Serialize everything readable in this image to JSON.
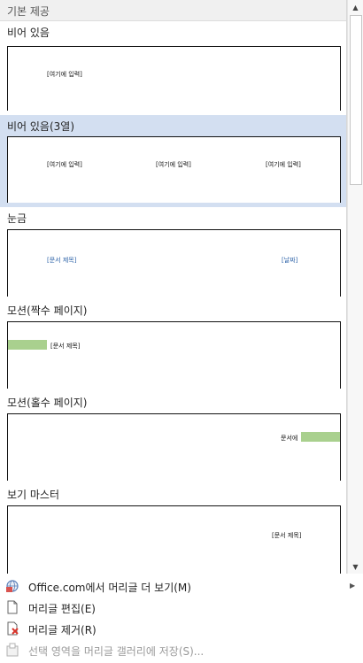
{
  "section": {
    "title": "기본 제공"
  },
  "items": [
    {
      "label": "비어 있음",
      "placeholders": [
        "[여기에 입력]"
      ]
    },
    {
      "label": "비어 있음(3열)",
      "placeholders": [
        "[여기에 입력]",
        "[여기에 입력]",
        "[여기에 입력]"
      ]
    },
    {
      "label": "눈금",
      "placeholders": [
        "[문서 제목]",
        "[날짜]"
      ]
    },
    {
      "label": "모션(짝수 페이지)",
      "placeholders": [
        "[문서 제목]"
      ]
    },
    {
      "label": "모션(홀수 페이지)",
      "placeholders": [
        "문서에"
      ]
    },
    {
      "label": "보기 마스터",
      "placeholders": [
        "[문서 제목]"
      ]
    }
  ],
  "menu": [
    {
      "label": "Office.com에서 머리글 더 보기(M)",
      "icon": "office-globe-icon",
      "enabled": true,
      "submenu": true
    },
    {
      "label": "머리글 편집(E)",
      "icon": "page-icon",
      "enabled": true
    },
    {
      "label": "머리글 제거(R)",
      "icon": "remove-page-icon",
      "enabled": true
    },
    {
      "label": "선택 영역을 머리글 갤러리에 저장(S)...",
      "icon": "save-selection-icon",
      "enabled": false
    }
  ],
  "colors": {
    "selected": "#d3dff1",
    "accent_green": "#a9d08e",
    "accent_blue": "#2e63a8"
  }
}
